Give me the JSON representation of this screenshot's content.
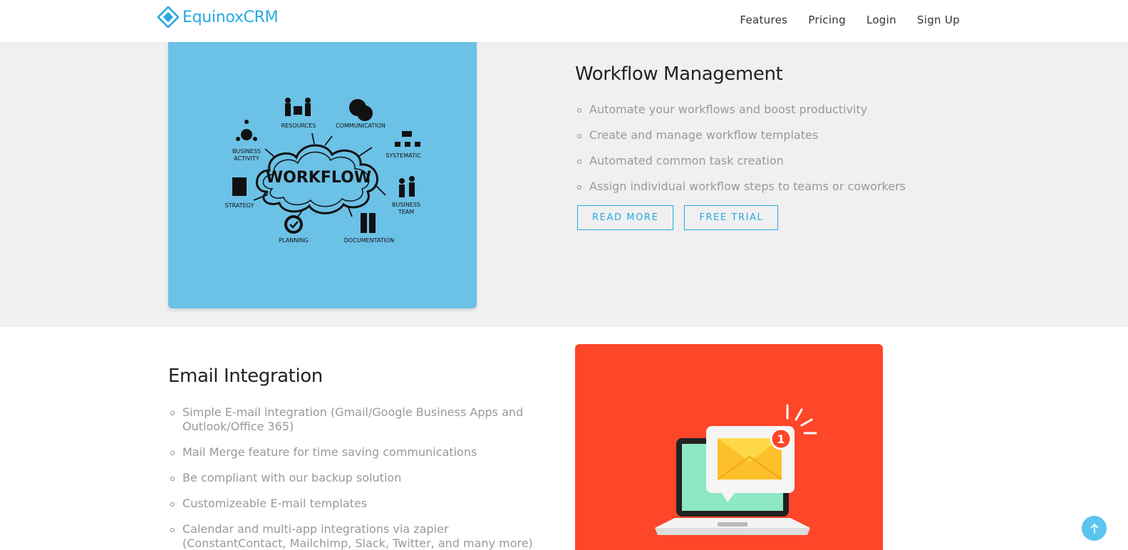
{
  "brand": {
    "name": "EquinoxCRM",
    "color": "#27a9e1"
  },
  "nav": {
    "items": [
      {
        "label": "Features"
      },
      {
        "label": "Pricing"
      },
      {
        "label": "Login"
      },
      {
        "label": "Sign Up"
      }
    ]
  },
  "workflow": {
    "title": "Workflow Management",
    "items": [
      "Automate your workflows and boost productivity",
      "Create and manage workflow templates",
      "Automated common task creation",
      "Assign individual workflow steps to teams or coworkers"
    ],
    "read_more_label": "READ MORE",
    "free_trial_label": "FREE TRIAL",
    "illustration": {
      "center": "WORKFLOW",
      "labels": [
        "RESOURCES",
        "COMMUNICATION",
        "BUSINESS",
        "ACTIVITY",
        "SYSTEMATIC",
        "STRATEGY",
        "BUSINESS",
        "TEAM",
        "PLANNING",
        "DOCUMENTATION"
      ],
      "bg_color": "#6bc1e6"
    }
  },
  "email": {
    "title": "Email Integration",
    "items": [
      "Simple E-mail integration (Gmail/Google Business Apps and Outlook/Office 365)",
      "Mail Merge feature for time saving communications",
      "Be compliant with our backup solution",
      "Customizeable E-mail templates",
      "Calendar and multi-app integrations via zapier (ConstantContact, Mailchimp, Slack, Twitter, and many more)"
    ],
    "illustration": {
      "badge_count": "1",
      "bg_color": "#fe4629"
    }
  },
  "scroll_top": {
    "icon": "arrow-up-icon",
    "color": "#5cc4ee"
  }
}
